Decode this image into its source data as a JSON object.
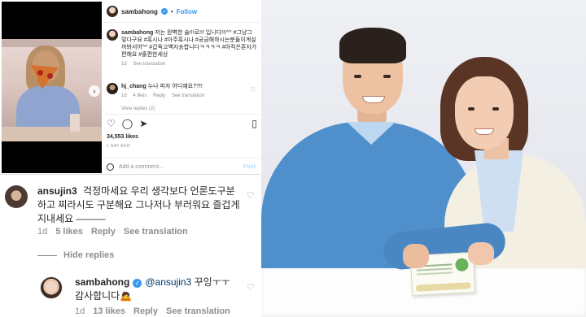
{
  "post": {
    "username": "sambahong",
    "follow_label": "Follow",
    "caption": "저는 완벽한 술!!!로!!! 입니다!!!^^ #그냥그렇다구요 #혹시나 #아주혹시나 #궁금해하시는분들이계실까봐서어^^ #갑독고백지송합니다ㅋㅋㅋㅋ #아직은혼자가편해요 #훌편한세상",
    "caption_age": "1d",
    "see_translation": "See translation",
    "comment": {
      "username": "hj_chang",
      "text": "누나 피자 어디예요??!!",
      "age": "1d",
      "likes": "4 likes",
      "reply": "Reply",
      "see_translation": "See translation"
    },
    "view_replies": "View replies (2)",
    "likes": "34,553 likes",
    "time_ago": "1 DAY AGO",
    "add_comment_placeholder": "Add a comment...",
    "post_button": "Post"
  },
  "thread": {
    "comment1": {
      "username": "ansujin3",
      "text": "걱정마세요 우리 생각보다 언론도구분하고 찌라시도 구분해요 그나저나 부러워요 즐겁게지내세요 ———",
      "age": "1d",
      "likes": "5 likes",
      "reply": "Reply",
      "see_translation": "See translation"
    },
    "hide_replies": "Hide replies",
    "reply1": {
      "username": "sambahong",
      "mention": "@ansujin3",
      "text": "꾸잉ㅜㅜ 감사합니다🙇",
      "age": "1d",
      "likes": "13 likes",
      "reply": "Reply",
      "see_translation": "See translation"
    }
  },
  "colors": {
    "link_blue": "#3897f0",
    "muted_gray": "#8e8e8e",
    "text_dark": "#262626"
  },
  "icons": [
    "heart-icon",
    "comment-icon",
    "share-icon",
    "bookmark-icon",
    "verified-badge-icon",
    "emoji-icon",
    "chevron-right-icon"
  ]
}
